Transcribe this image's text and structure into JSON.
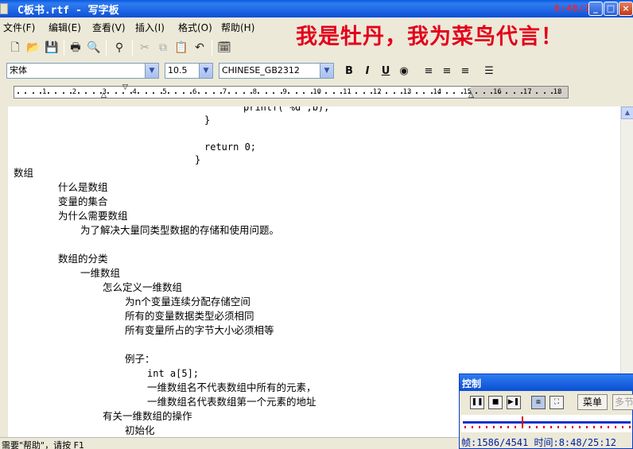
{
  "window": {
    "title": "C板书.rtf - 写字板",
    "clock": "8:48/25:12"
  },
  "menus": [
    "文件(F)",
    "编辑(E)",
    "查看(V)",
    "插入(I)",
    "格式(O)",
    "帮助(H)"
  ],
  "slogan": "我是牡丹，我为菜鸟代言！",
  "format": {
    "font_name": "宋体",
    "font_size": "10.5",
    "script": "CHINESE_GB2312"
  },
  "ruler": {
    "numbers": [
      "1",
      "2",
      "3",
      "4",
      "5",
      "6",
      "7",
      "8",
      "9",
      "10",
      "11",
      "12",
      "13",
      "14",
      "15",
      "16",
      "17",
      "18"
    ]
  },
  "document": {
    "lines": [
      "printf(\"%d\",b);",
      "}",
      "return 0;",
      "}",
      "数组",
      "什么是数组",
      "变量的集合",
      "为什么需要数组",
      "为了解决大量同类型数据的存储和使用问题。",
      "数组的分类",
      "一维数组",
      "怎么定义一维数组",
      "为n个变量连续分配存储空间",
      "所有的变量数据类型必须相同",
      "所有变量所占的字节大小必须相等",
      "例子：",
      "int a[5];",
      "一维数组名不代表数组中所有的元素，",
      "一维数组名代表数组第一个元素的地址",
      "有关一维数组的操作",
      "初始化"
    ]
  },
  "statusbar": {
    "text": "需要\"帮助\"，请按 F1"
  },
  "control_panel": {
    "title": "控制",
    "menu_button": "菜单",
    "more_button": "多节",
    "frame_label": "帧:1586/4541",
    "time_label": "时间:8:48/25:12",
    "progress": 0.35
  }
}
